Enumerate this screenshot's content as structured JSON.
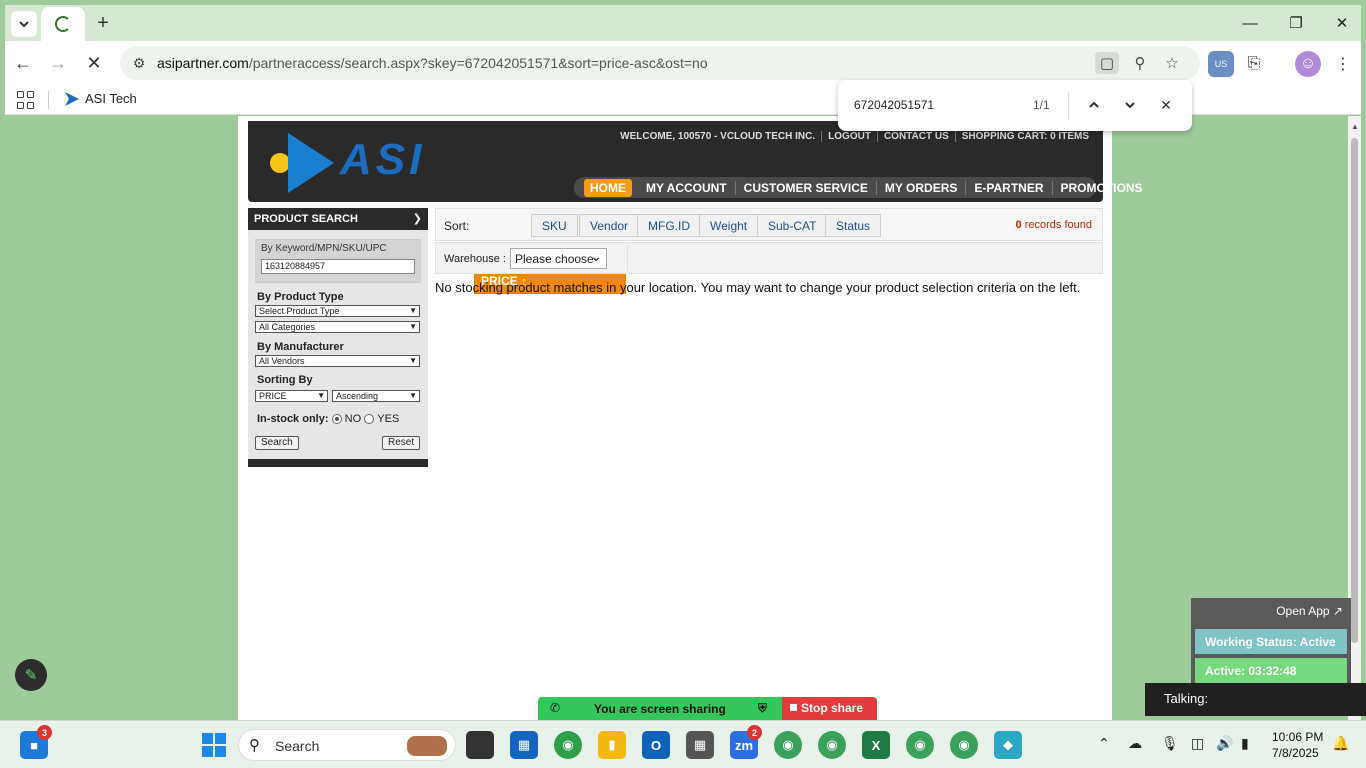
{
  "browser": {
    "url_host": "asipartner.com",
    "url_rest": "/partneraccess/search.aspx?skey=672042051571&sort=price-asc&ost=no",
    "bookmark": "ASI Tech"
  },
  "find": {
    "query": "672042051571",
    "count": "1/1"
  },
  "site": {
    "logo_text": "ASI",
    "toplinks": [
      "WELCOME, 100570 - VCLOUD TECH INC.",
      "LOGOUT",
      "CONTACT US",
      "SHOPPING CART: 0 ITEMS"
    ],
    "nav": [
      "HOME",
      "MY ACCOUNT",
      "CUSTOMER SERVICE",
      "MY ORDERS",
      "E-PARTNER",
      "PROMOTIONS"
    ]
  },
  "search_panel": {
    "title": "PRODUCT SEARCH",
    "keyword_label": "By Keyword/MPN/SKU/UPC",
    "keyword_value": "163120884957",
    "product_type_label": "By Product Type",
    "product_type_select": "Select Product Type",
    "categories_select": "All Categories",
    "manufacturer_label": "By Manufacturer",
    "vendors_select": "All Vendors",
    "sorting_label": "Sorting By",
    "sort_field": "PRICE",
    "sort_order": "Ascending",
    "instock_label": "In-stock only:",
    "instock_no": "NO",
    "instock_yes": "YES",
    "instock_value": "NO",
    "search_button": "Search",
    "reset_button": "Reset"
  },
  "sortbar": {
    "label": "Sort:",
    "buttons": [
      "PRICE ↑",
      "SKU",
      "Vendor",
      "MFG.ID",
      "Weight",
      "Sub-CAT",
      "Status"
    ],
    "records_count": "0",
    "records_text": "records found"
  },
  "warehouse": {
    "label": "Warehouse :",
    "value": "Please choose"
  },
  "message": "No stocking product matches in your location. You may want to change your product selection criteria on the left.",
  "status_widget": {
    "open_app": "Open App ↗",
    "working_status": "Working Status: Active",
    "active_time": "Active: 03:32:48",
    "talking": "Talking:"
  },
  "screen_share": {
    "text": "You are screen sharing",
    "stop": "Stop share"
  },
  "taskbar": {
    "search_label": "Search",
    "widget_badge": "3",
    "zoom_badge": "2",
    "time": "10:06 PM",
    "date": "7/8/2025"
  }
}
